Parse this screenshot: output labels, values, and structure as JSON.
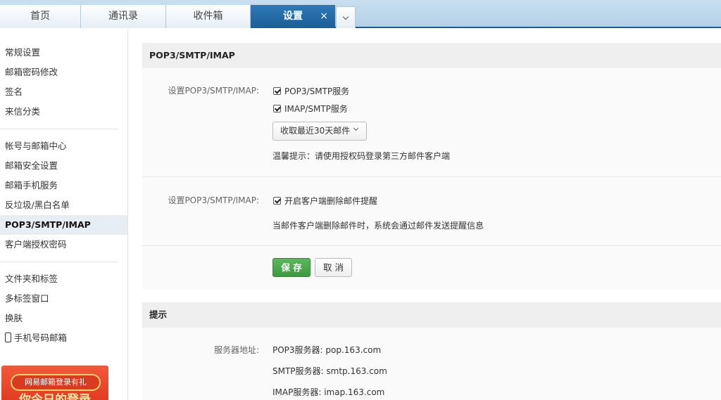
{
  "tabs": [
    {
      "label": "首页"
    },
    {
      "label": "通讯录"
    },
    {
      "label": "收件箱"
    },
    {
      "label": "设置",
      "close": "×"
    }
  ],
  "sidebar": {
    "groups": [
      [
        "常规设置",
        "邮箱密码修改",
        "签名",
        "来信分类"
      ],
      [
        "帐号与邮箱中心",
        "邮箱安全设置",
        "邮箱手机服务",
        "反垃圾/黑白名单",
        "POP3/SMTP/IMAP",
        "客户端授权密码"
      ],
      [
        "文件夹和标签",
        "多标签窗口",
        "换肤",
        "手机号码邮箱"
      ]
    ],
    "active": "POP3/SMTP/IMAP",
    "promo": {
      "tag": "网易邮箱登录有礼",
      "headline": "你今日的登录"
    }
  },
  "settings": {
    "title": "POP3/SMTP/IMAP",
    "row1_label": "设置POP3/SMTP/IMAP:",
    "pop3_smtp": {
      "label": "POP3/SMTP服务",
      "checked": true
    },
    "imap_smtp": {
      "label": "IMAP/SMTP服务",
      "checked": true
    },
    "fetch_select": "收取最近30天邮件",
    "tip": "温馨提示：请使用授权码登录第三方邮件客户端",
    "row2_label": "设置POP3/SMTP/IMAP:",
    "delete_remind": {
      "label": "开启客户端删除邮件提醒",
      "checked": true
    },
    "delete_desc": "当邮件客户端删除邮件时，系统会通过邮件发送提醒信息",
    "save": "保 存",
    "cancel": "取 消"
  },
  "hints": {
    "title": "提示",
    "server_label": "服务器地址:",
    "pop3": "POP3服务器: pop.163.com",
    "smtp": "SMTP服务器: smtp.163.com",
    "imap": "IMAP服务器: imap.163.com"
  }
}
